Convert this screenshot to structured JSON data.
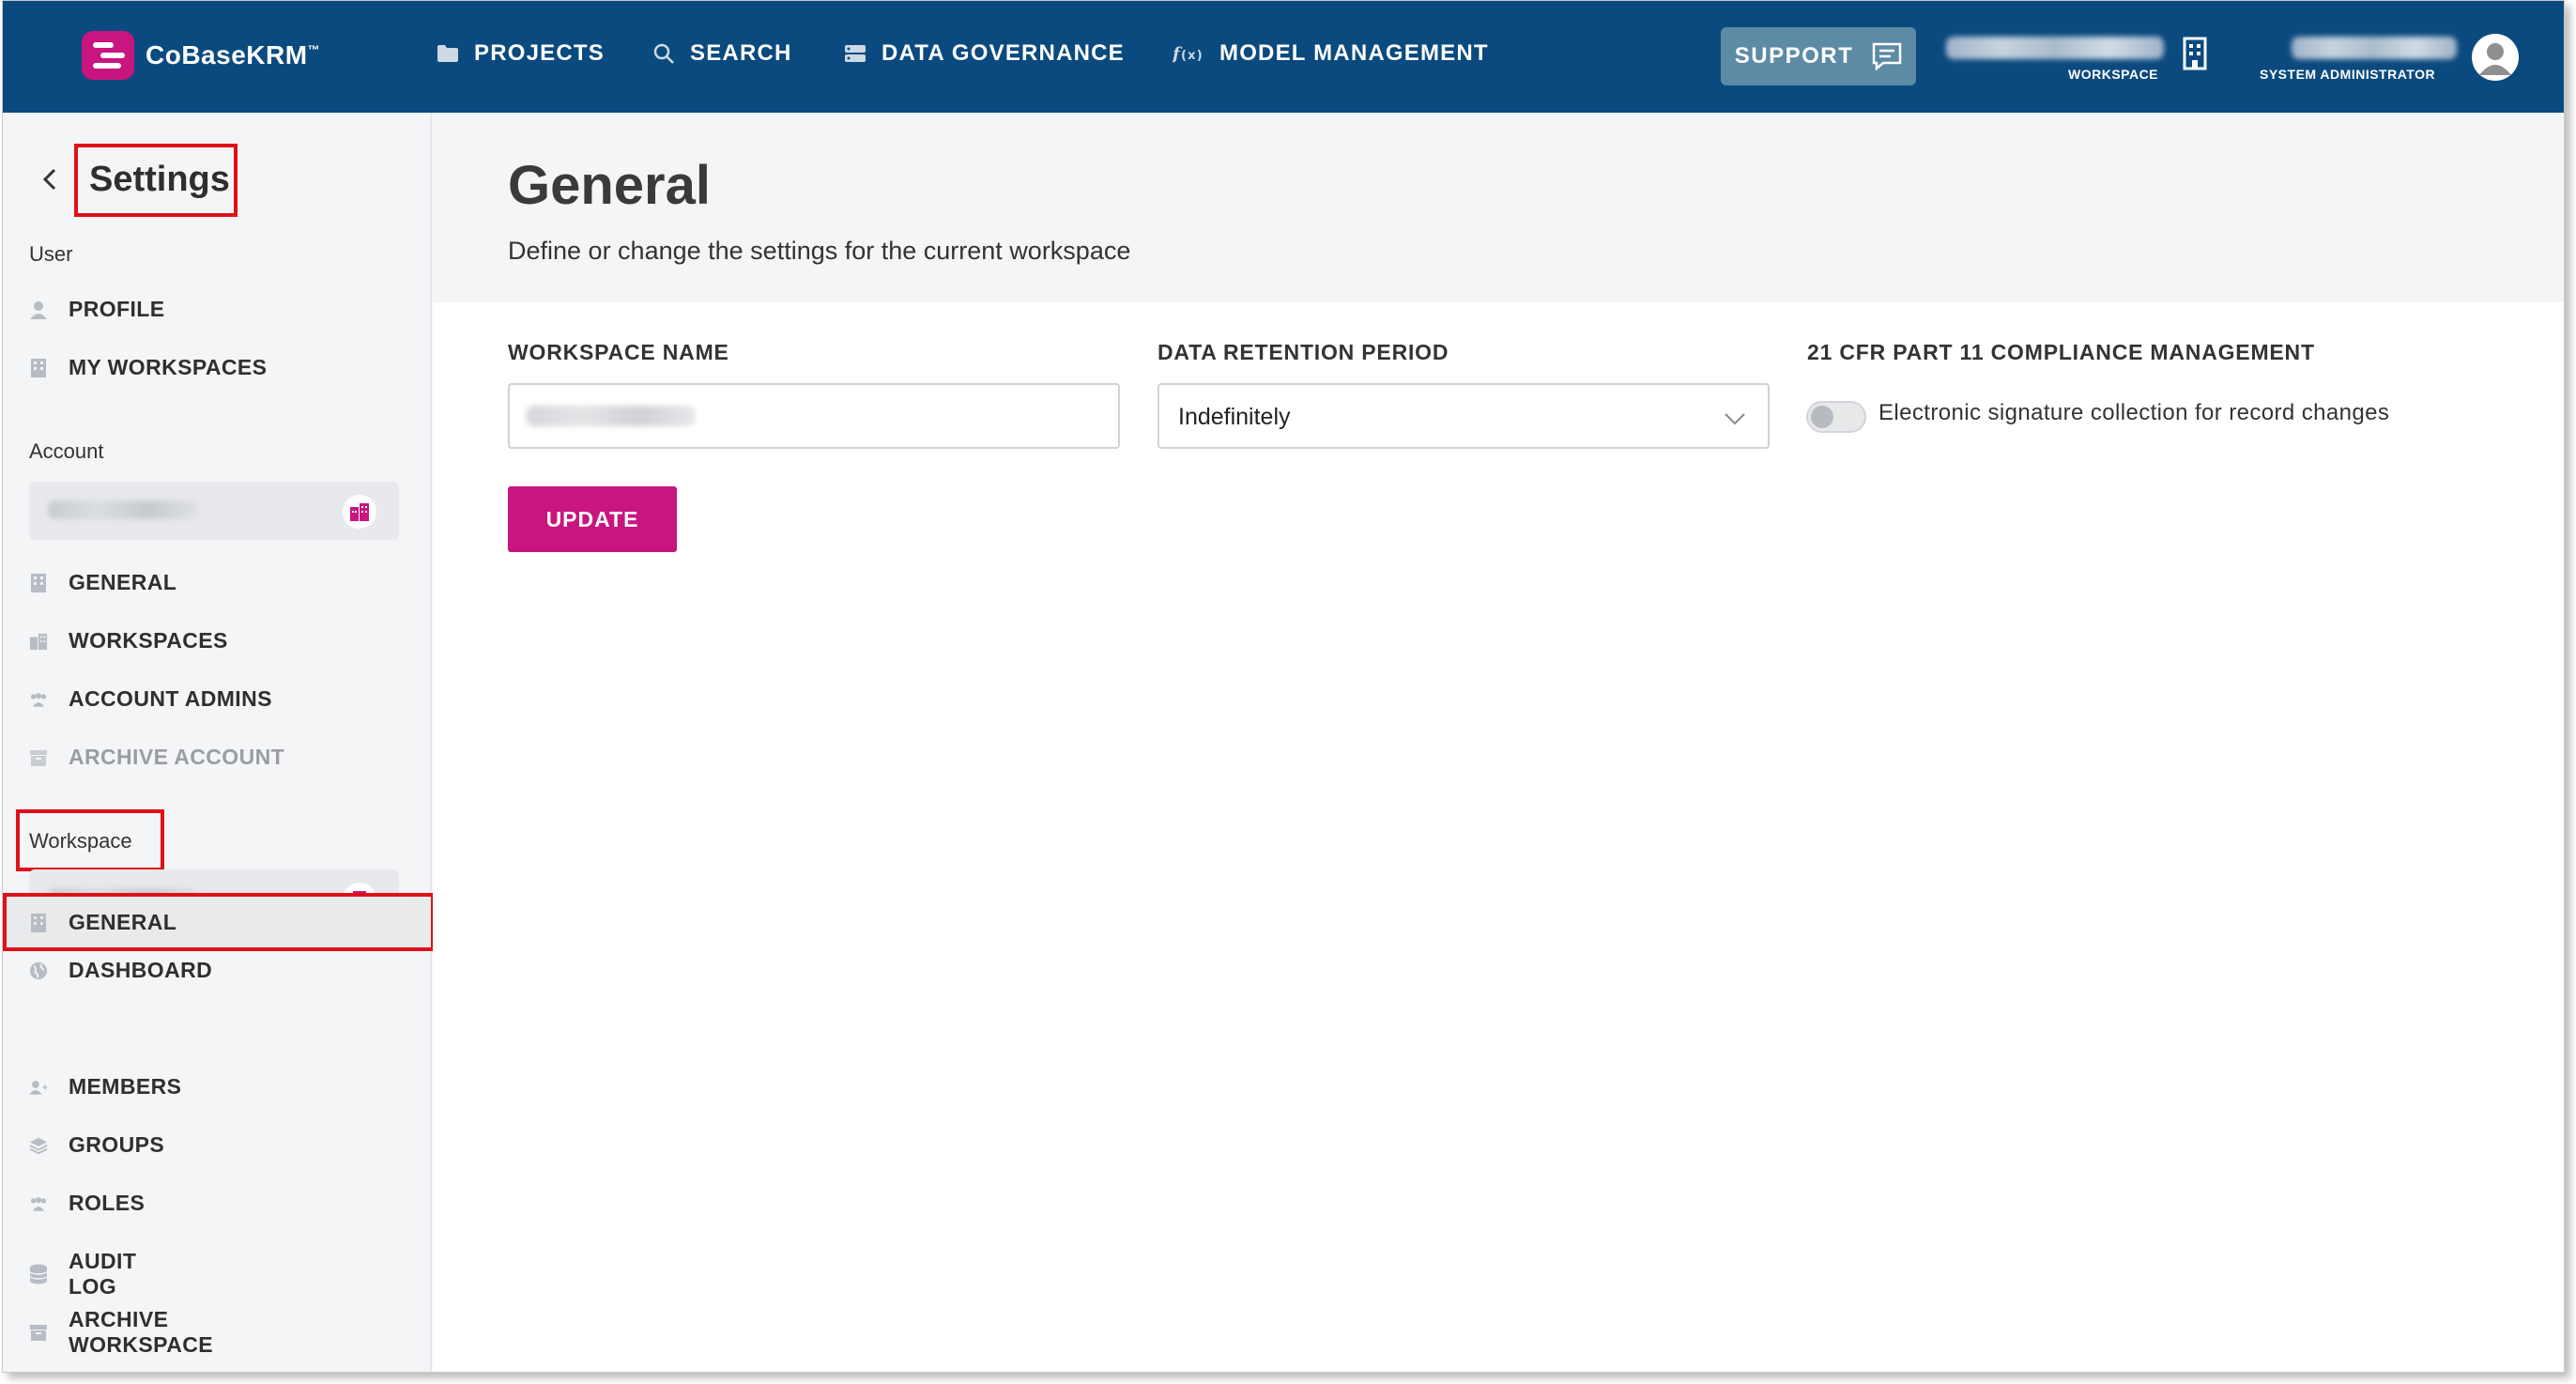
{
  "header": {
    "logo_text": "CoBaseKRM",
    "logo_tm": "™",
    "nav": [
      {
        "label": "PROJECTS",
        "icon": "folder-icon"
      },
      {
        "label": "SEARCH",
        "icon": "search-icon"
      },
      {
        "label": "DATA GOVERNANCE",
        "icon": "database-icon"
      },
      {
        "label": "MODEL MANAGEMENT",
        "icon": "function-icon"
      }
    ],
    "support_label": "SUPPORT",
    "workspace_caption": "WORKSPACE",
    "role_caption": "SYSTEM ADMINISTRATOR"
  },
  "sidebar": {
    "back_icon": "chevron-left-icon",
    "title": "Settings",
    "user_section": "User",
    "user_items": [
      {
        "label": "PROFILE",
        "icon": "person-icon"
      },
      {
        "label": "MY WORKSPACES",
        "icon": "building-icon"
      }
    ],
    "account_section": "Account",
    "account_items": [
      {
        "label": "GENERAL",
        "icon": "building-icon"
      },
      {
        "label": "WORKSPACES",
        "icon": "buildings-icon"
      },
      {
        "label": "ACCOUNT ADMINS",
        "icon": "people-icon"
      },
      {
        "label": "ARCHIVE ACCOUNT",
        "icon": "archive-icon",
        "disabled": true
      }
    ],
    "workspace_section": "Workspace",
    "workspace_items": [
      {
        "label": "DASHBOARD",
        "icon": "globe-icon"
      },
      {
        "label": "GENERAL",
        "icon": "building-icon",
        "active": true
      },
      {
        "label": "MEMBERS",
        "icon": "add-person-icon"
      },
      {
        "label": "GROUPS",
        "icon": "layers-icon"
      },
      {
        "label": "ROLES",
        "icon": "people-icon"
      },
      {
        "label": "AUDIT LOG",
        "icon": "database-icon"
      },
      {
        "label": "ARCHIVE WORKSPACE",
        "icon": "archive-icon"
      }
    ]
  },
  "main": {
    "title": "General",
    "subtitle": "Define or change the settings for the current workspace",
    "workspace_name_label": "WORKSPACE NAME",
    "retention_label": "DATA RETENTION PERIOD",
    "retention_value": "Indefinitely",
    "compliance_label": "21 CFR PART 11 COMPLIANCE MANAGEMENT",
    "compliance_toggle_label": "Electronic signature collection for record changes",
    "compliance_toggle_on": false,
    "update_label": "UPDATE"
  },
  "colors": {
    "header_bg": "#0b4a7e",
    "accent": "#c8157f",
    "support_bg": "#5d8aa5",
    "highlight_box": "#e0101a"
  }
}
